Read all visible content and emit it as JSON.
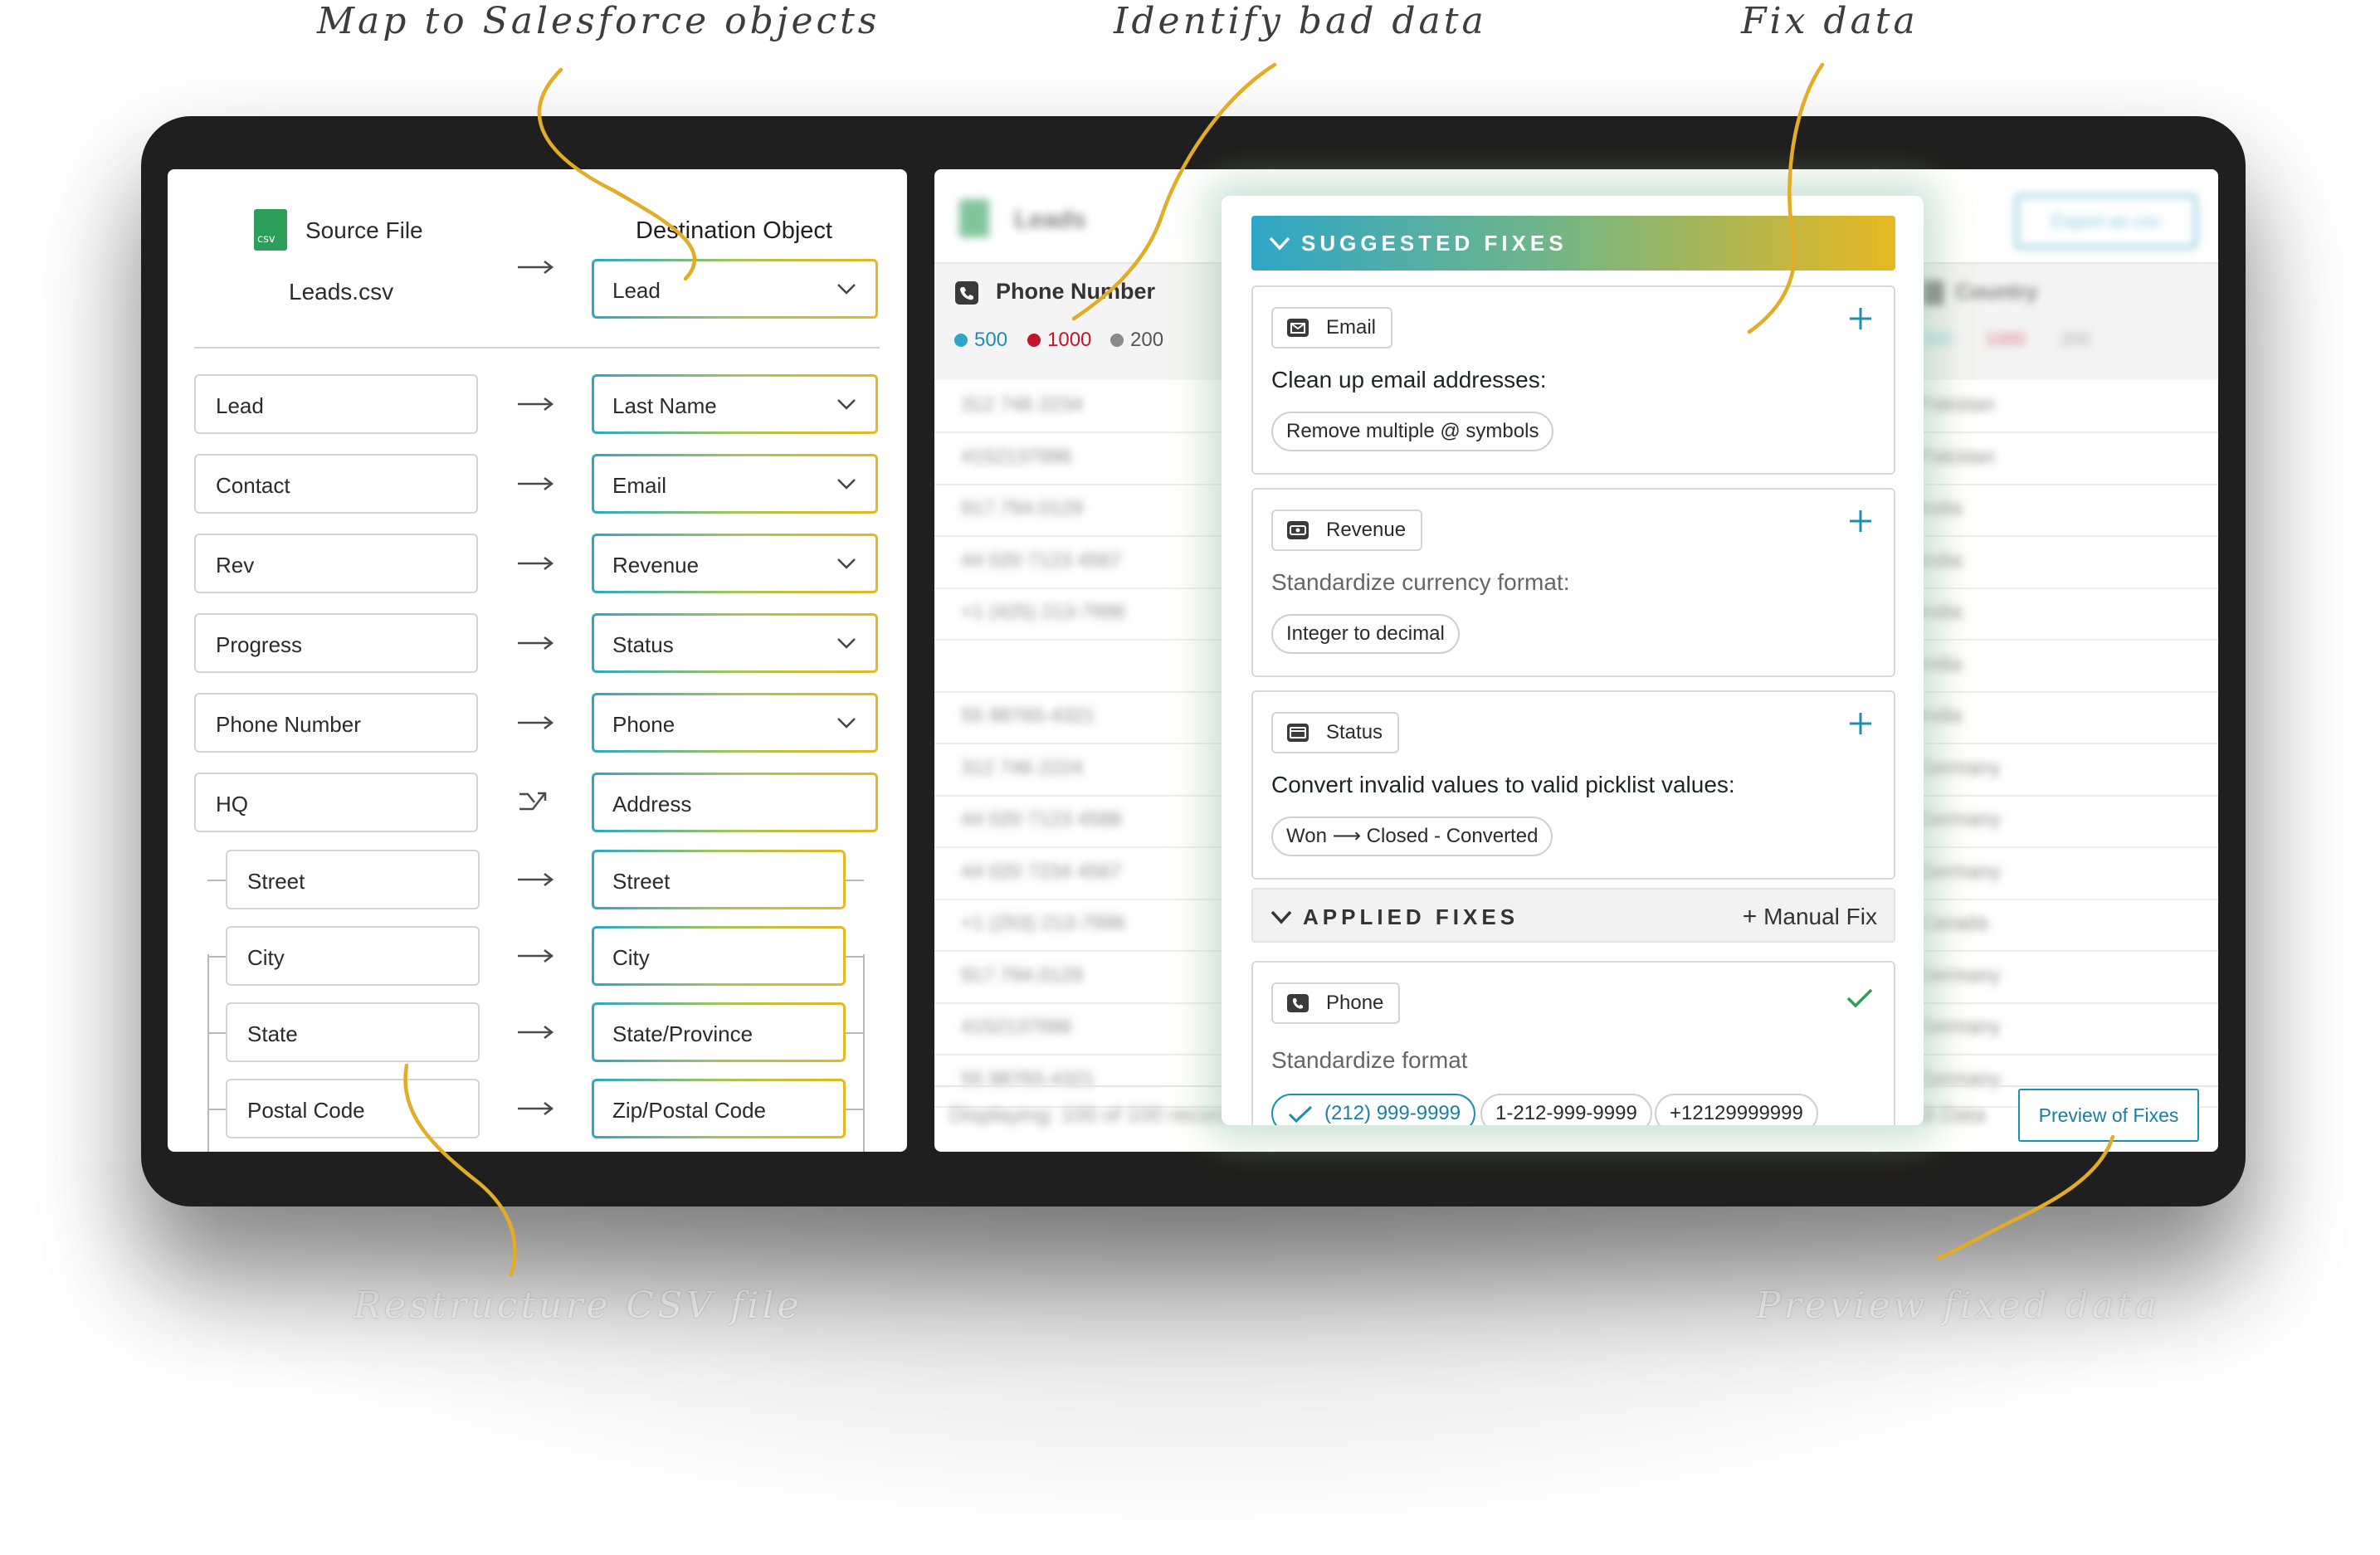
{
  "callouts": {
    "map": "Map to Salesforce objects",
    "identify": "Identify bad data",
    "fix": "Fix data",
    "restructure": "Restructure CSV file",
    "preview": "Preview fixed data"
  },
  "colors": {
    "accent_gold": "#e2ac27",
    "accent_teal": "#2fa6c7",
    "error_red": "#c0152b",
    "check_green": "#2e9e5b"
  },
  "mapping": {
    "source_label": "Source File",
    "source_file": "Leads.csv",
    "destination_label": "Destination Object",
    "destination_value": "Lead",
    "rows": [
      {
        "source": "Lead",
        "target": "Last Name",
        "dropdown": true
      },
      {
        "source": "Contact",
        "target": "Email",
        "dropdown": true
      },
      {
        "source": "Rev",
        "target": "Revenue",
        "dropdown": true
      },
      {
        "source": "Progress",
        "target": "Status",
        "dropdown": true
      },
      {
        "source": "Phone Number",
        "target": "Phone",
        "dropdown": true
      },
      {
        "source": "HQ",
        "target": "Address",
        "dropdown": false
      }
    ],
    "sub_rows": [
      {
        "source": "Street",
        "target": "Street"
      },
      {
        "source": "City",
        "target": "City"
      },
      {
        "source": "State",
        "target": "State/Province"
      },
      {
        "source": "Postal Code",
        "target": "Zip/Postal Code"
      }
    ]
  },
  "data_table": {
    "title": "Leads",
    "export_label": "Export as csv",
    "phone_header": "Phone Number",
    "country_header": "Country",
    "counts": {
      "blue": "500",
      "red": "1000",
      "gray": "200"
    },
    "phones": [
      "312 746 2234",
      "4152137996",
      "917.794.0129",
      "44 020 7123 4567",
      "+1 (425) 213-7996",
      "",
      "55 98765-4321",
      "312 746 2224",
      "44 020 7123 4588",
      "44 020 7234 4567",
      "+1 (253) 213-7996",
      "917.794.0129",
      "4152137996",
      "55 98765-4321"
    ],
    "countries": [
      "Pakistan",
      "Pakistan",
      "India",
      "India",
      "India",
      "India",
      "India",
      "Germany",
      "Germany",
      "Germany",
      "Canada",
      "Germany",
      "Germany",
      "Germany"
    ],
    "footer_display": "Displaying: 100 of 100 records",
    "footer_right": "All Data",
    "preview_button": "Preview of Fixes"
  },
  "fixes": {
    "suggested_title": "SUGGESTED FIXES",
    "applied_title": "APPLIED FIXES",
    "manual_fix": "Manual Fix",
    "suggested": [
      {
        "field": "Email",
        "icon": "envelope-icon",
        "description": "Clean up email addresses:",
        "options": [
          "Remove multiple @ symbols"
        ]
      },
      {
        "field": "Revenue",
        "icon": "currency-icon",
        "description": "Standardize currency format:",
        "options": [
          "Integer to decimal"
        ]
      },
      {
        "field": "Status",
        "icon": "picklist-icon",
        "description": "Convert invalid values to valid picklist values:",
        "options": [
          "Won ⟶ Closed - Converted"
        ]
      }
    ],
    "applied": [
      {
        "field": "Phone",
        "icon": "phone-icon",
        "description": "Standardize format",
        "options": [
          "(212) 999-9999",
          "1-212-999-9999",
          "+12129999999"
        ],
        "selected": "(212) 999-9999"
      }
    ]
  }
}
